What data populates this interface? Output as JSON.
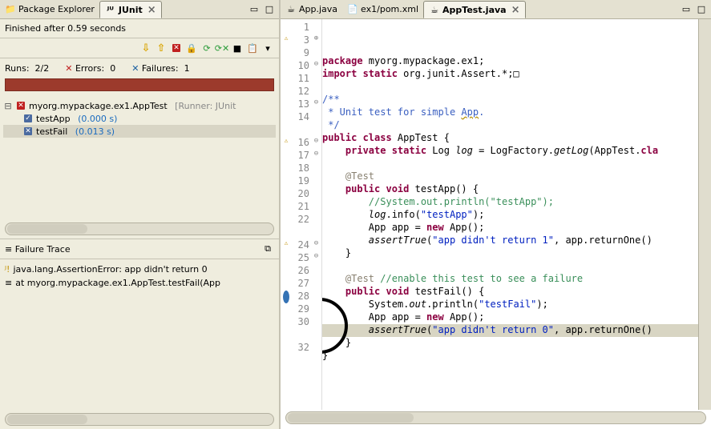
{
  "left": {
    "tabs": [
      {
        "label": "Package Explorer",
        "active": false
      },
      {
        "label": "JUnit",
        "active": true
      }
    ],
    "status": "Finished after 0.59 seconds",
    "counters": {
      "runs_label": "Runs:",
      "runs_value": "2/2",
      "errors_label": "Errors:",
      "errors_value": "0",
      "failures_label": "Failures:",
      "failures_value": "1"
    },
    "tree": {
      "root": {
        "label": "myorg.mypackage.ex1.AppTest",
        "suffix": "[Runner: JUnit"
      },
      "children": [
        {
          "label": "testApp",
          "time": "(0.000 s)",
          "icon": "pass"
        },
        {
          "label": "testFail",
          "time": "(0.013 s)",
          "icon": "fail"
        }
      ]
    },
    "failure_trace": {
      "title": "Failure Trace",
      "lines": [
        "java.lang.AssertionError: app didn't return 0",
        "at myorg.mypackage.ex1.AppTest.testFail(App"
      ]
    }
  },
  "right": {
    "tabs": [
      {
        "label": "App.java",
        "active": false
      },
      {
        "label": "ex1/pom.xml",
        "active": false
      },
      {
        "label": "AppTest.java",
        "active": true
      }
    ],
    "line_numbers": [
      "1",
      "3",
      "9",
      "10",
      "11",
      "12",
      "13",
      "14",
      "",
      "16",
      "17",
      "18",
      "19",
      "20",
      "21",
      "22",
      "",
      "24",
      "25",
      "26",
      "27",
      "28",
      "29",
      "30",
      "",
      "32"
    ],
    "code_lines": [
      {
        "html": "<span class='kw'>package</span> myorg.mypackage.ex1;"
      },
      {
        "html": "<span class='kw'>import static</span> org.junit.Assert.*;□"
      },
      {
        "html": ""
      },
      {
        "html": "<span class='jdoc'>/**</span>"
      },
      {
        "html": "<span class='jdoc'> * Unit test for simple <span class='flagged'>App</span>.</span>"
      },
      {
        "html": "<span class='jdoc'> */</span>"
      },
      {
        "html": "<span class='kw'>public class</span> AppTest {"
      },
      {
        "html": "    <span class='kw'>private static</span> Log <i>log</i> = LogFactory.<i>getLog</i>(AppTest.<span class='kw'>cla</span>"
      },
      {
        "html": ""
      },
      {
        "html": "    <span class='ann'>@Test</span>"
      },
      {
        "html": "    <span class='kw'>public void</span> testApp() {"
      },
      {
        "html": "        <span class='cmt'>//System.out.println(\"testApp\");</span>"
      },
      {
        "html": "        <i>log</i>.info(<span class='str'>\"testApp\"</span>);"
      },
      {
        "html": "        App app = <span class='kw'>new</span> App();"
      },
      {
        "html": "        <i>assertTrue</i>(<span class='str'>\"app didn't return 1\"</span>, app.returnOne()"
      },
      {
        "html": "    }"
      },
      {
        "html": ""
      },
      {
        "html": "    <span class='ann'>@Test</span> <span class='cmt'>//enable this test to see a failure</span>"
      },
      {
        "html": "    <span class='kw'>public void</span> testFail() {"
      },
      {
        "html": "        System.<i>out</i>.println(<span class='str'>\"testFail\"</span>);"
      },
      {
        "html": "        App app = <span class='kw'>new</span> App();"
      },
      {
        "html": "        <i>assertTrue</i>(<span class='str'>\"app didn't return 0\"</span>, app.returnOne()",
        "hl": true
      },
      {
        "html": "    }"
      },
      {
        "html": "}"
      },
      {
        "html": ""
      },
      {
        "html": ""
      }
    ],
    "fold_rows": {
      "1": "⊕",
      "3": "⊖",
      "6": "⊖",
      "9": "⊖",
      "10": "⊖",
      "17": "⊖",
      "18": "⊖"
    },
    "marker_rows": {
      "1": "warn",
      "9": "warn",
      "17": "warn",
      "21": "breakpoint"
    }
  }
}
